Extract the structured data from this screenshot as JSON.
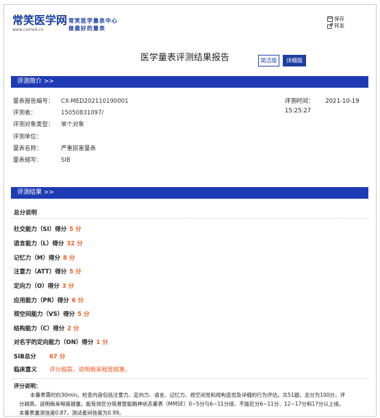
{
  "header": {
    "logo_text": "常笑医学网",
    "logo_url": "www.cxmed.cn",
    "slogan_line1": "常笑医学量表中心",
    "slogan_line2": "做最好的量表",
    "save_label": "保存",
    "share_label": "转发"
  },
  "report": {
    "title": "医学量表评测结果报告",
    "simple_label": "简洁版",
    "detail_label": "详细版"
  },
  "intro": {
    "section_title": "评测简介 >>",
    "rows": [
      {
        "label": "量表报告编号：",
        "value": "CX-MED202110190001"
      },
      {
        "label": "评测者：",
        "value": "15050831097/"
      },
      {
        "label": "评测对象类型：",
        "value": "单个对象"
      },
      {
        "label": "评测单位：",
        "value": ""
      },
      {
        "label": "量表名称：",
        "value": "严重损害量表"
      },
      {
        "label": "量表缩写：",
        "value": "SIB"
      }
    ],
    "time_label": "评测时间：",
    "time_value": "2021-10-19 15:25:27"
  },
  "result": {
    "section_title": "评测结果 >>",
    "subhead": "总分说明",
    "scores": [
      {
        "label": "社交能力（SI）得分",
        "value": "5 分"
      },
      {
        "label": "语言能力（L）得分",
        "value": "32 分"
      },
      {
        "label": "记忆力（M）得分",
        "value": "8 分"
      },
      {
        "label": "注意力（ATT）得分",
        "value": "5 分"
      },
      {
        "label": "定向力（O）得分",
        "value": "3 分"
      },
      {
        "label": "应用能力（PR）得分",
        "value": "6 分"
      },
      {
        "label": "视空间能力（VS）得分",
        "value": "5 分"
      },
      {
        "label": "结构能力（C）得分",
        "value": "2 分"
      },
      {
        "label": "对名字的定向能力（ON）得分",
        "value": "1 分"
      }
    ],
    "total_label": "SIB总分",
    "total_value": "67 分",
    "clinical_label": "临床意义",
    "clinical_value": "评分越高，说明痴呆程度越重。",
    "explain_head": "评分说明：",
    "explain_body": "本量表需时约30min。检查内容包括注意力、定向力、语言、记忆力、视空间觉和视构造觉及详细的行为评估。共51题，总分为100分，评分越高，说明痴呆程度越重。能有效区分简易智能精神状态量表（MMSE）0~5分与6~11分组、不能区分6~11分、12~17分和17分以上组。本量表重测信度0.87，测试者间信度为0.99。"
  },
  "colors": {
    "brand": "#1d3fa0",
    "section_bar": "#1f3bb3",
    "score_accent": "#f05a24"
  }
}
